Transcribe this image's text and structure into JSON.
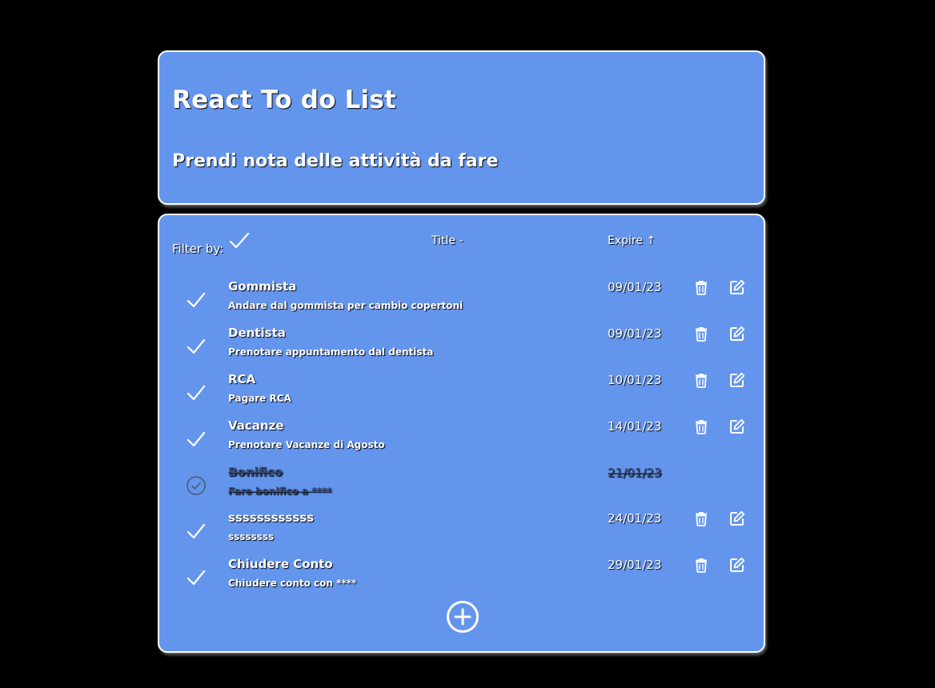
{
  "header": {
    "title": "React To do List",
    "subtitle": "Prendi nota delle attività da fare"
  },
  "toolbar": {
    "filter_label": "Filter by:",
    "filter_icon": "check-icon",
    "title_sort_label": "Title -",
    "expire_sort_label": "Expire ↑"
  },
  "todos": [
    {
      "title": "Gommista",
      "description": "Andare dal gommista per cambio copertoni",
      "date": "09/01/23",
      "done": false
    },
    {
      "title": "Dentista",
      "description": "Prenotare appuntamento dal dentista",
      "date": "09/01/23",
      "done": false
    },
    {
      "title": "RCA",
      "description": "Pagare RCA",
      "date": "10/01/23",
      "done": false
    },
    {
      "title": "Vacanze",
      "description": "Prenotare Vacanze di Agosto",
      "date": "14/01/23",
      "done": false
    },
    {
      "title": "Bonifico",
      "description": "Fare bonifico a ****",
      "date": "21/01/23",
      "done": true
    },
    {
      "title": "ssssssssssss",
      "description": "ssssssss",
      "date": "24/01/23",
      "done": false
    },
    {
      "title": "Chiudere Conto",
      "description": "Chiudere conto con ****",
      "date": "29/01/23",
      "done": false
    }
  ],
  "icons": {
    "delete": "trash-icon",
    "edit": "edit-icon",
    "add": "plus-circle-icon",
    "done": "check-circle-icon"
  },
  "colors": {
    "background": "#000000",
    "card": "#6495ed",
    "text": "#ffffff",
    "done_text": "#3a4f78"
  }
}
